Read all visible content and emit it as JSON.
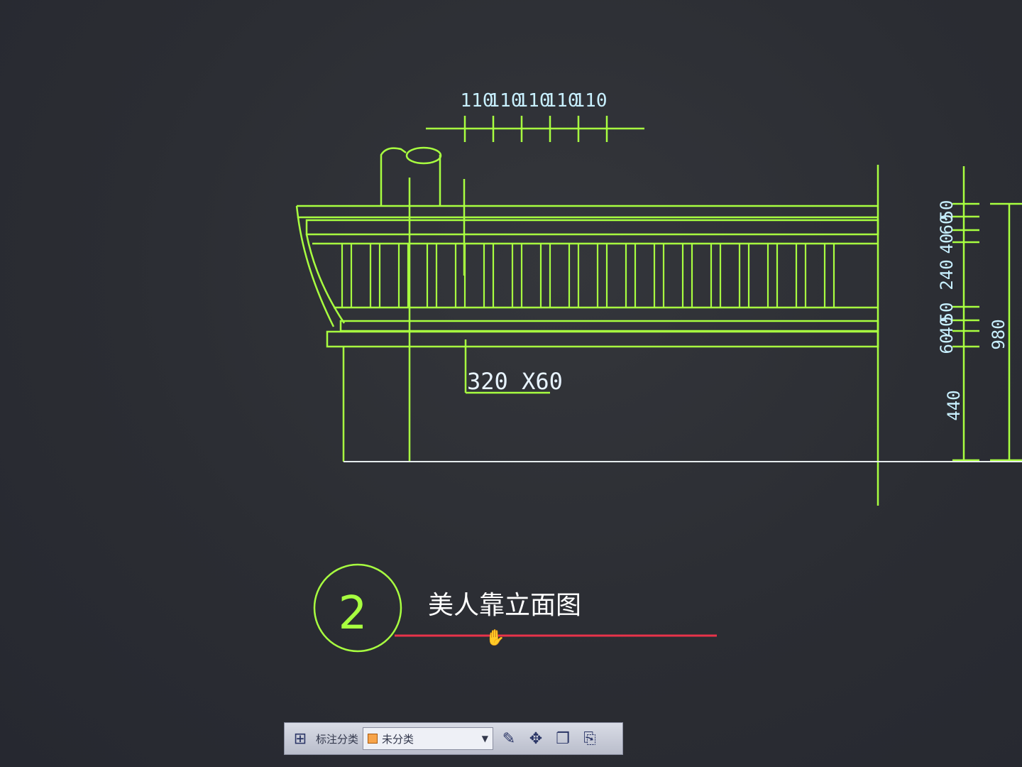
{
  "drawing": {
    "top_dimensions": [
      "110",
      "110",
      "110",
      "110",
      "110"
    ],
    "right_dimensions": [
      "50",
      "60",
      "40",
      "240",
      "50",
      "40",
      "60"
    ],
    "right_dimension_low": "440",
    "right_dimension_total": "980",
    "member_label": "320 X60",
    "detail_number": "2",
    "detail_title": "美人靠立面图"
  },
  "toolbar": {
    "category_label": "标注分类",
    "category_value": "未分类"
  },
  "colors": {
    "line": "#a8ff40",
    "title_underline": "#e8334a",
    "background": "#2b2d33",
    "swatch": "#f7a44a"
  }
}
